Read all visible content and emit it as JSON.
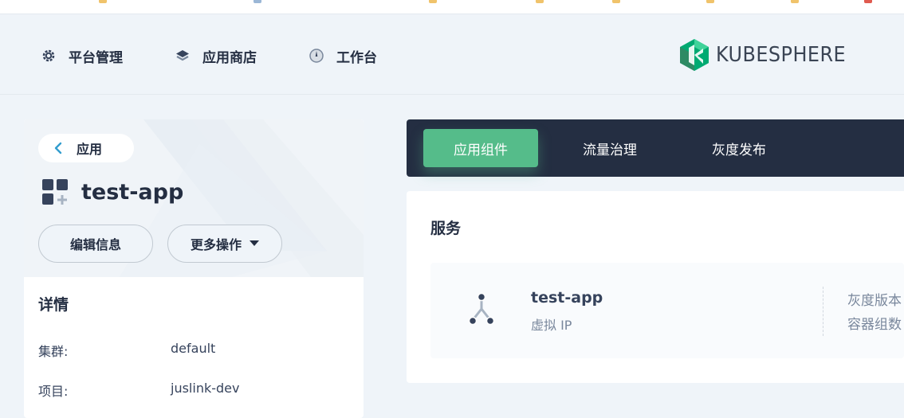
{
  "topnav": {
    "items": [
      {
        "label": "平台管理",
        "icon": "gear-icon"
      },
      {
        "label": "应用商店",
        "icon": "layers-icon"
      },
      {
        "label": "工作台",
        "icon": "dashboard-icon"
      }
    ],
    "logo_text": "KUBESPHERE"
  },
  "app": {
    "back_label": "应用",
    "name": "test-app",
    "edit_button": "编辑信息",
    "more_button": "更多操作"
  },
  "details": {
    "title": "详情",
    "rows": [
      {
        "key": "集群:",
        "value": "default"
      },
      {
        "key": "项目:",
        "value": "juslink-dev"
      }
    ]
  },
  "tabs": [
    {
      "label": "应用组件",
      "active": true
    },
    {
      "label": "流量治理",
      "active": false
    },
    {
      "label": "灰度发布",
      "active": false
    }
  ],
  "services": {
    "title": "服务",
    "items": [
      {
        "name": "test-app",
        "subtitle": "虚拟 IP",
        "right_line1": "灰度版本",
        "right_line2": "容器组数"
      }
    ]
  },
  "colors": {
    "accent": "#55bc8a",
    "dark": "#242e42",
    "background": "#eff4f9"
  }
}
